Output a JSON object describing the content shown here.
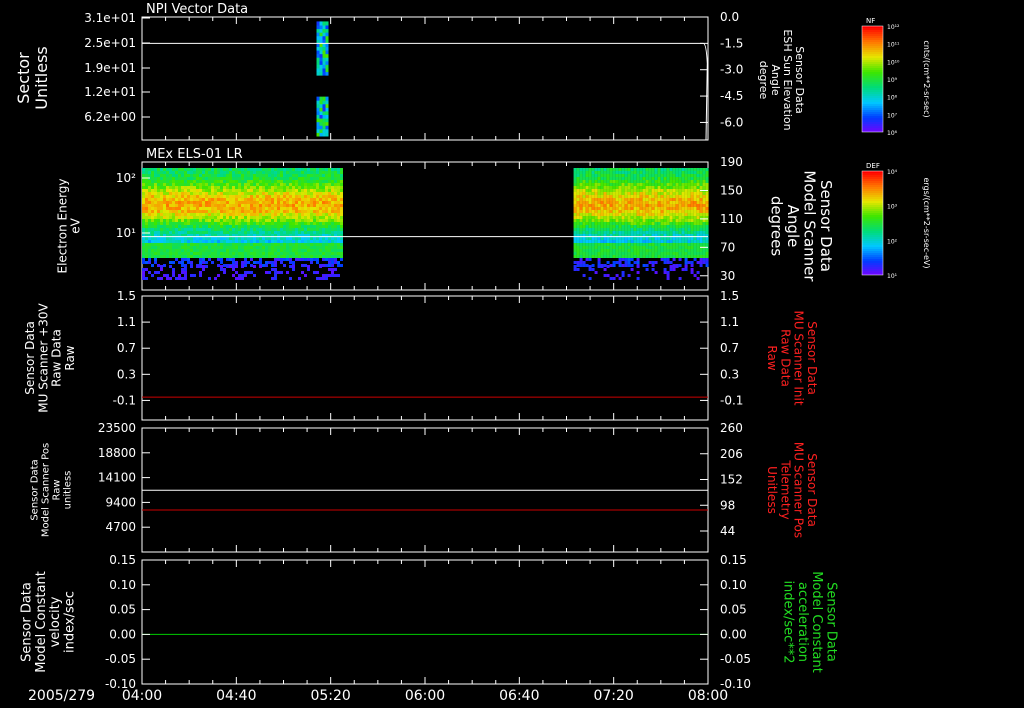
{
  "time_axis": {
    "date_label": "2005/279",
    "ticks": [
      "04:00",
      "04:40",
      "05:20",
      "06:00",
      "06:40",
      "07:20",
      "08:00"
    ],
    "range": [
      "04:00",
      "08:00"
    ]
  },
  "colors": {
    "axis": "#ffffff",
    "red_trace": "#cc0000",
    "green_trace": "#00cc00",
    "red_label": "#ff2020",
    "green_label": "#22dd22"
  },
  "chart_data": [
    {
      "type": "heatmap",
      "title": "NPI Vector Data",
      "ylabel_left": [
        "Sector",
        "Unitless"
      ],
      "yticks_left": [
        "3.1e+01",
        "2.5e+01",
        "1.9e+01",
        "1.2e+01",
        "6.2e+00"
      ],
      "ylabel_right": [
        "Sensor Data",
        "ESH Sun Elevation",
        "Angle",
        "degree"
      ],
      "yticks_right": [
        "0.0",
        "-1.5",
        "-3.0",
        "-4.5",
        "-6.0"
      ],
      "ylim_right": [
        -7,
        0
      ],
      "colorbar": {
        "label": "NF",
        "ticks": [
          "10¹²",
          "10¹¹",
          "10¹⁰",
          "10⁹",
          "10⁸",
          "10⁷",
          "10⁶"
        ],
        "units": "cnts/(cm**2-sr-sec)"
      },
      "data_blocks": [
        {
          "start": "05:14",
          "end": "05:18",
          "sector_range": [
            17,
            31
          ]
        },
        {
          "start": "05:14",
          "end": "05:18",
          "sector_range": [
            0,
            10
          ]
        }
      ],
      "line": {
        "name": "ESH Sun Elevation",
        "value": -1.5,
        "until": "07:58",
        "drops_to": -7
      }
    },
    {
      "type": "heatmap",
      "title": "MEx ELS-01 LR",
      "ylabel_left": [
        "Electron Energy",
        "eV"
      ],
      "yticks_left": [
        "10²",
        "10¹"
      ],
      "ylabel_right": [
        "Sensor Data",
        "Model Scanner",
        "Angle",
        "degrees"
      ],
      "yticks_right": [
        "190",
        "150",
        "110",
        "70",
        "30"
      ],
      "ylim_right": [
        10,
        190
      ],
      "colorbar": {
        "label": "DEF",
        "ticks": [
          "10⁴",
          "10³",
          "10²",
          "10¹"
        ],
        "units": "ergs/(cm**2-sr-sec-eV)"
      },
      "data_intervals": [
        [
          "04:00",
          "05:24"
        ],
        [
          "07:03",
          "08:00"
        ]
      ],
      "line": {
        "name": "Model Scanner Angle",
        "value": 85
      }
    },
    {
      "type": "line",
      "ylabel_left": [
        "Sensor Data",
        "MU Scanner +30V",
        "Raw Data",
        "Raw"
      ],
      "yticks_left": [
        "1.5",
        "1.1",
        "0.7",
        "0.3",
        "-0.1"
      ],
      "ylim_left": [
        -0.4,
        1.5
      ],
      "ylabel_right": [
        "Sensor Data",
        "MU Scanner Init",
        "Raw Data",
        "Raw"
      ],
      "yticks_right": [
        "1.5",
        "1.1",
        "0.7",
        "0.3",
        "-0.1"
      ],
      "ylim_right": [
        -0.4,
        1.5
      ],
      "series": [
        {
          "axis": "right",
          "color": "red",
          "value": -0.05
        }
      ]
    },
    {
      "type": "line",
      "ylabel_left": [
        "Sensor Data",
        "Model Scanner Pos",
        "Raw",
        "unitless"
      ],
      "yticks_left": [
        "23500",
        "18800",
        "14100",
        "9400",
        "4700"
      ],
      "ylim_left": [
        0,
        23500
      ],
      "ylabel_right": [
        "Sensor Data",
        "MU Scanner Pos",
        "Telemetry",
        "Unitless"
      ],
      "yticks_right": [
        "260",
        "206",
        "152",
        "98",
        "44"
      ],
      "ylim_right": [
        0,
        260
      ],
      "series": [
        {
          "axis": "left",
          "color": "white",
          "value": 11700
        },
        {
          "axis": "right",
          "color": "red",
          "value": 88
        }
      ]
    },
    {
      "type": "line",
      "ylabel_left": [
        "Sensor Data",
        "Model Constant",
        "velocity",
        "index/sec"
      ],
      "yticks_left": [
        "0.15",
        "0.10",
        "0.05",
        "0.00",
        "-0.05",
        "-0.10"
      ],
      "ylim_left": [
        -0.1,
        0.15
      ],
      "ylabel_right": [
        "Sensor Data",
        "Model Constant",
        "acceleration",
        "index/sec**2"
      ],
      "yticks_right": [
        "0.15",
        "0.10",
        "0.05",
        "0.00",
        "-0.05",
        "-0.10"
      ],
      "ylim_right": [
        -0.1,
        0.15
      ],
      "series": [
        {
          "axis": "left",
          "color": "green",
          "value": 0.0
        }
      ]
    }
  ]
}
